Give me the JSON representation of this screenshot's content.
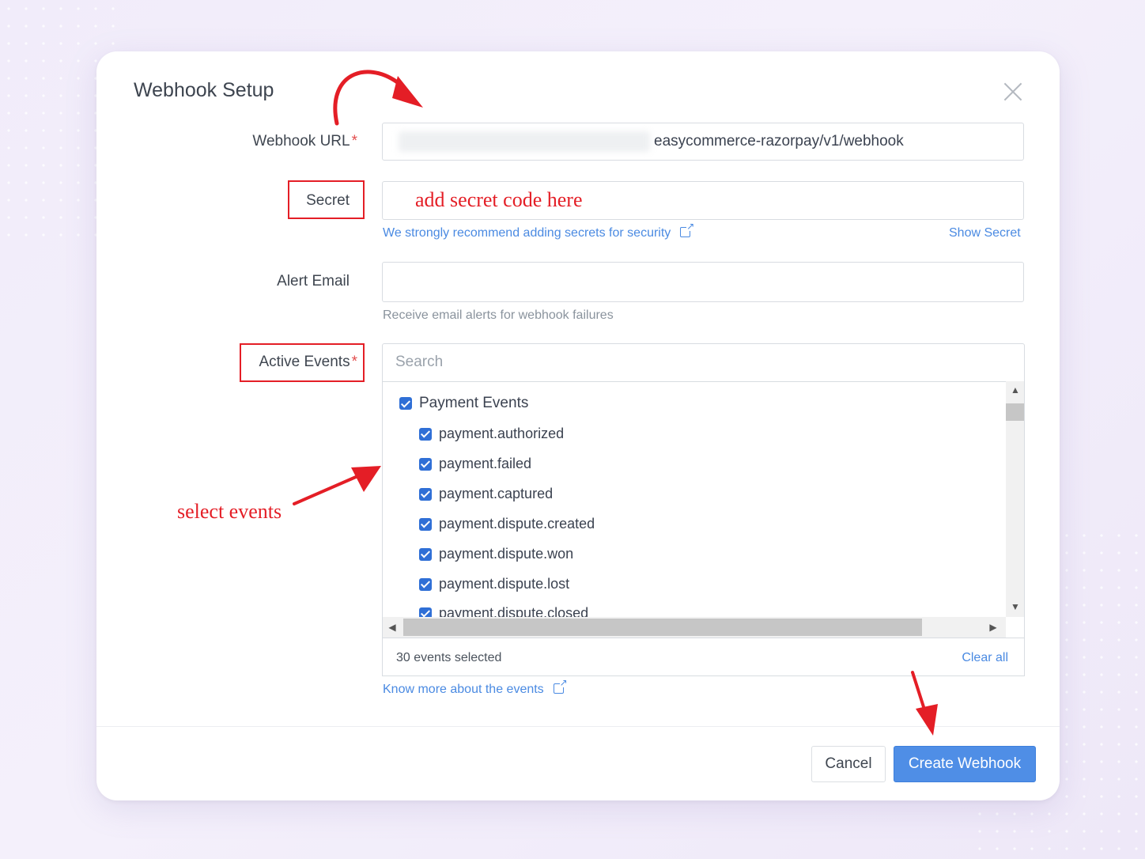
{
  "modal": {
    "title": "Webhook Setup"
  },
  "form": {
    "webhook_url": {
      "label": "Webhook URL",
      "required_marker": "*",
      "value": "easycommerce-razorpay/v1/webhook"
    },
    "secret": {
      "label": "Secret",
      "hint": "We strongly recommend adding secrets for security",
      "show_link": "Show Secret"
    },
    "alert_email": {
      "label": "Alert Email",
      "hint": "Receive email alerts for webhook failures"
    },
    "active_events": {
      "label": "Active Events",
      "required_marker": "*",
      "search_placeholder": "Search",
      "group": "Payment Events",
      "events": [
        "payment.authorized",
        "payment.failed",
        "payment.captured",
        "payment.dispute.created",
        "payment.dispute.won",
        "payment.dispute.lost",
        "payment.dispute.closed"
      ],
      "selected_count": "30 events selected",
      "clear_all": "Clear all",
      "know_more": "Know more about the events"
    }
  },
  "actions": {
    "cancel": "Cancel",
    "create": "Create Webhook"
  },
  "annotations": {
    "secret_placeholder_note": "add secret code here",
    "select_events_note": "select events",
    "color": "#e41e26"
  },
  "icons": [
    "close-icon",
    "external-link-icon",
    "checkbox-checked-icon",
    "chevron-up-icon",
    "chevron-down-icon",
    "chevron-left-icon",
    "chevron-right-icon"
  ]
}
